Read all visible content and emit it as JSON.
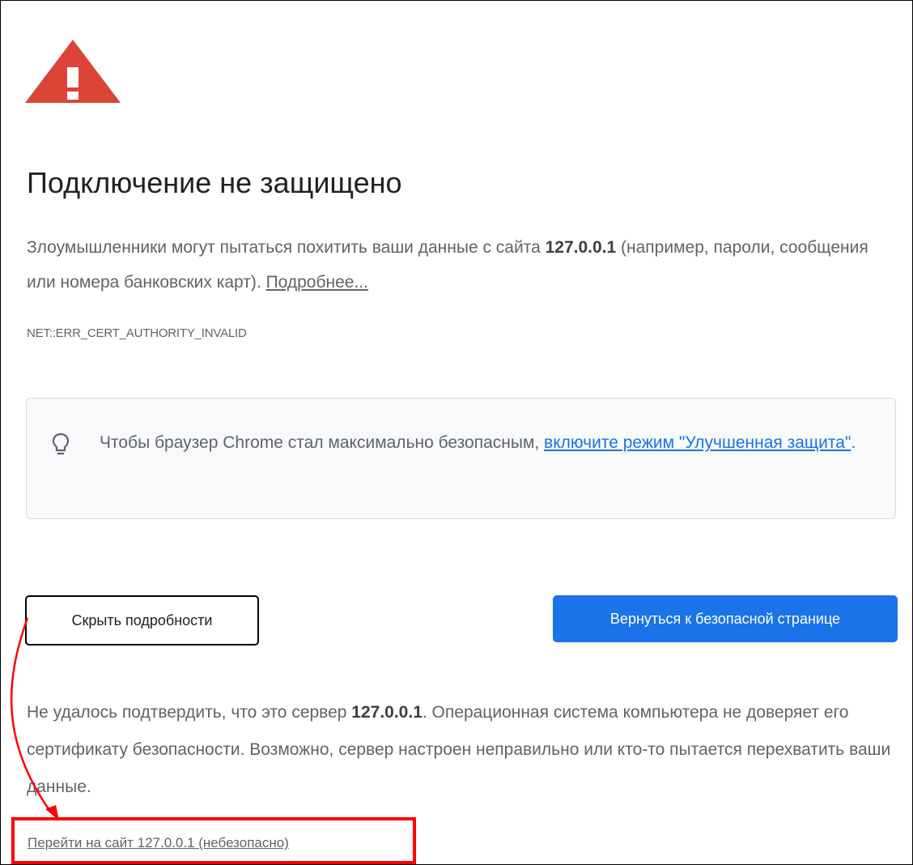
{
  "page": {
    "title": "Подключение не защищено",
    "intro": {
      "text_before": "Злоумышленники могут пытаться похитить ваши данные с сайта ",
      "host": "127.0.0.1",
      "text_after": " (например, пароли, сообщения или номера банковских карт). ",
      "learn_more_label": "Подробнее..."
    },
    "error_code": "NET::ERR_CERT_AUTHORITY_INVALID"
  },
  "tip": {
    "icon": "lightbulb-icon",
    "text_before": "Чтобы браузер Chrome стал максимально безопасным, ",
    "link_label": "включите режим \"Улучшенная защита\"",
    "text_after": "."
  },
  "buttons": {
    "hide_details_label": "Скрыть подробности",
    "back_to_safety_label": "Вернуться к безопасной странице"
  },
  "details": {
    "text_before": "Не удалось подтвердить, что это сервер ",
    "host": "127.0.0.1",
    "text_after": ". Операционная система компьютера не доверяет его сертификату безопасности. Возможно, сервер настроен неправильно или кто-то пытается перехватить ваши данные.",
    "proceed_link_label": "Перейти на сайт 127.0.0.1 (небезопасно)"
  },
  "colors": {
    "warning_red": "#db4437",
    "primary_blue": "#1a73e8",
    "annotation_red": "#ff0000"
  }
}
